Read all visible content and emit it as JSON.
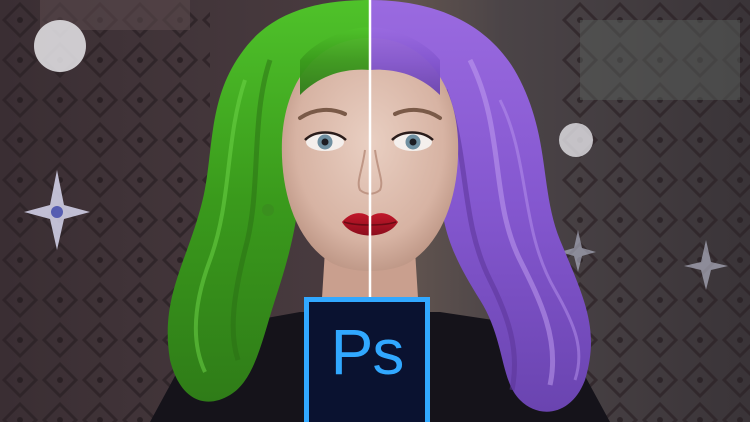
{
  "image": {
    "subject": "before-after-hair-color",
    "left_hair_color": "#3fae1f",
    "right_hair_color": "#8b5fd6",
    "divider_color": "#ffffff"
  },
  "logo": {
    "text": "Ps",
    "accent_color": "#31a8ff",
    "background_color": "#0a1230"
  }
}
